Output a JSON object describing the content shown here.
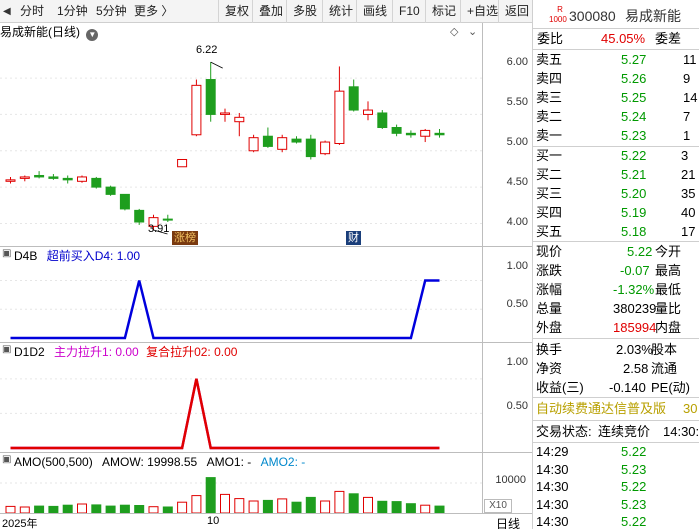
{
  "toolbar": {
    "items": [
      "分时",
      "1分钟",
      "5分钟",
      "更多 〉",
      "复权",
      "叠加",
      "多股",
      "统计",
      "画线",
      "F10",
      "标记",
      "+自选",
      "返回"
    ]
  },
  "main_chart": {
    "title": "易成新能(日线)",
    "y_ticks": [
      "6.00",
      "5.50",
      "5.00",
      "4.50",
      "4.00"
    ],
    "high_label": "6.22",
    "low_label": "3.91",
    "tag_zhangbang": "涨榜",
    "tag_cai": "财"
  },
  "d4b_pane": {
    "name": "D4B",
    "series_label": "超前买入D4: 1.00",
    "y_ticks": [
      "1.00",
      "0.50"
    ]
  },
  "d1d2_pane": {
    "name": "D1D2",
    "series1_label": "主力拉升1: 0.00",
    "series2_label": "复合拉升02: 0.00",
    "y_ticks": [
      "1.00",
      "0.50"
    ]
  },
  "amo_pane": {
    "label": "AMO(500,500)",
    "amow": "AMOW: 19998.55",
    "amo1": "AMO1: -",
    "amo2": "AMO2: -",
    "y_tick": "10000",
    "unit": "X10"
  },
  "bottom_axis": {
    "year": "2025年",
    "month": "10",
    "period": "日线"
  },
  "quote": {
    "badge_top": "R",
    "badge_bottom": "1000",
    "code": "300080",
    "name": "易成新能",
    "weibi_label": "委比",
    "weibi_value": "45.05%",
    "weicha_label": "委差",
    "sell_rows": [
      {
        "label": "卖五",
        "price": "5.27",
        "vol": "11"
      },
      {
        "label": "卖四",
        "price": "5.26",
        "vol": "9"
      },
      {
        "label": "卖三",
        "price": "5.25",
        "vol": "14"
      },
      {
        "label": "卖二",
        "price": "5.24",
        "vol": "7"
      },
      {
        "label": "卖一",
        "price": "5.23",
        "vol": "1"
      }
    ],
    "buy_rows": [
      {
        "label": "买一",
        "price": "5.22",
        "vol": "3"
      },
      {
        "label": "买二",
        "price": "5.21",
        "vol": "21"
      },
      {
        "label": "买三",
        "price": "5.20",
        "vol": "35"
      },
      {
        "label": "买四",
        "price": "5.19",
        "vol": "40"
      },
      {
        "label": "买五",
        "price": "5.18",
        "vol": "17"
      }
    ],
    "stats": [
      {
        "label": "现价",
        "value": "5.22",
        "label2": "今开"
      },
      {
        "label": "涨跌",
        "value": "-0.07",
        "label2": "最高"
      },
      {
        "label": "涨幅",
        "value": "-1.32%",
        "label2": "最低"
      },
      {
        "label": "总量",
        "value": "380239",
        "label2": "量比"
      },
      {
        "label": "外盘",
        "value": "185994",
        "label2": "内盘"
      }
    ],
    "stats2": [
      {
        "label": "换手",
        "value": "2.03%",
        "label2": "股本"
      },
      {
        "label": "净资",
        "value": "2.58",
        "label2": "流通"
      },
      {
        "label": "收益(三)",
        "value": "-0.140",
        "label2": "PE(动)"
      }
    ],
    "banner": "自动续费通达信普及版",
    "banner_num": "30",
    "trade_status_label": "交易状态:",
    "trade_status_value": "连续竞价",
    "trade_status_time": "14:30:2",
    "ticks": [
      {
        "time": "14:29",
        "price": "5.22"
      },
      {
        "time": "14:30",
        "price": "5.23"
      },
      {
        "time": "14:30",
        "price": "5.22"
      },
      {
        "time": "14:30",
        "price": "5.23"
      },
      {
        "time": "14:30",
        "price": "5.22"
      }
    ]
  },
  "chart_data": [
    {
      "type": "candlestick",
      "title": "易成新能(日线)",
      "ylim": [
        3.8,
        6.4
      ],
      "candles": [
        {
          "o": 4.6,
          "h": 4.64,
          "l": 4.55,
          "c": 4.58,
          "color": "red"
        },
        {
          "o": 4.62,
          "h": 4.66,
          "l": 4.58,
          "c": 4.64,
          "color": "red"
        },
        {
          "o": 4.66,
          "h": 4.72,
          "l": 4.62,
          "c": 4.64,
          "color": "green"
        },
        {
          "o": 4.64,
          "h": 4.68,
          "l": 4.6,
          "c": 4.62,
          "color": "green"
        },
        {
          "o": 4.62,
          "h": 4.66,
          "l": 4.55,
          "c": 4.6,
          "color": "green"
        },
        {
          "o": 4.58,
          "h": 4.66,
          "l": 4.56,
          "c": 4.64,
          "color": "red"
        },
        {
          "o": 4.62,
          "h": 4.64,
          "l": 4.48,
          "c": 4.5,
          "color": "green"
        },
        {
          "o": 4.5,
          "h": 4.52,
          "l": 4.38,
          "c": 4.4,
          "color": "green"
        },
        {
          "o": 4.4,
          "h": 4.4,
          "l": 4.18,
          "c": 4.2,
          "color": "green"
        },
        {
          "o": 4.18,
          "h": 4.2,
          "l": 3.98,
          "c": 4.02,
          "color": "green"
        },
        {
          "o": 3.96,
          "h": 4.12,
          "l": 3.91,
          "c": 4.08,
          "color": "red"
        },
        {
          "o": 4.06,
          "h": 4.12,
          "l": 4.02,
          "c": 4.06,
          "color": "green"
        },
        {
          "o": 4.78,
          "h": 4.88,
          "l": 4.78,
          "c": 4.88,
          "color": "red"
        },
        {
          "o": 5.22,
          "h": 5.98,
          "l": 5.2,
          "c": 5.9,
          "color": "red"
        },
        {
          "o": 5.98,
          "h": 6.22,
          "l": 5.4,
          "c": 5.5,
          "color": "green"
        },
        {
          "o": 5.52,
          "h": 5.58,
          "l": 5.4,
          "c": 5.5,
          "color": "red"
        },
        {
          "o": 5.4,
          "h": 5.52,
          "l": 5.2,
          "c": 5.46,
          "color": "red"
        },
        {
          "o": 5.0,
          "h": 5.22,
          "l": 4.98,
          "c": 5.18,
          "color": "red"
        },
        {
          "o": 5.2,
          "h": 5.32,
          "l": 5.04,
          "c": 5.06,
          "color": "green"
        },
        {
          "o": 5.02,
          "h": 5.22,
          "l": 4.98,
          "c": 5.18,
          "color": "red"
        },
        {
          "o": 5.16,
          "h": 5.2,
          "l": 5.1,
          "c": 5.12,
          "color": "green"
        },
        {
          "o": 5.16,
          "h": 5.22,
          "l": 4.88,
          "c": 4.92,
          "color": "green"
        },
        {
          "o": 4.96,
          "h": 5.14,
          "l": 4.94,
          "c": 5.12,
          "color": "red"
        },
        {
          "o": 5.1,
          "h": 6.16,
          "l": 5.08,
          "c": 5.82,
          "color": "red"
        },
        {
          "o": 5.88,
          "h": 5.98,
          "l": 5.54,
          "c": 5.56,
          "color": "green"
        },
        {
          "o": 5.56,
          "h": 5.68,
          "l": 5.42,
          "c": 5.5,
          "color": "red"
        },
        {
          "o": 5.52,
          "h": 5.56,
          "l": 5.3,
          "c": 5.32,
          "color": "green"
        },
        {
          "o": 5.32,
          "h": 5.36,
          "l": 5.2,
          "c": 5.24,
          "color": "green"
        },
        {
          "o": 5.24,
          "h": 5.28,
          "l": 5.18,
          "c": 5.22,
          "color": "green"
        },
        {
          "o": 5.2,
          "h": 5.3,
          "l": 5.12,
          "c": 5.28,
          "color": "red"
        },
        {
          "o": 5.24,
          "h": 5.3,
          "l": 5.18,
          "c": 5.22,
          "color": "green"
        }
      ]
    },
    {
      "type": "line",
      "title": "D4B",
      "series": [
        {
          "name": "超前买入D4",
          "values": [
            0,
            0,
            0,
            0,
            0,
            0,
            0,
            0,
            0,
            1,
            0,
            0,
            0,
            0,
            0,
            0,
            0,
            0,
            0,
            0,
            0,
            0,
            0,
            0,
            0,
            0,
            0,
            0,
            0,
            1,
            1
          ]
        }
      ],
      "ylim": [
        0,
        1.2
      ]
    },
    {
      "type": "line",
      "title": "D1D2",
      "series": [
        {
          "name": "主力拉升1",
          "values": [
            0,
            0,
            0,
            0,
            0,
            0,
            0,
            0,
            0,
            0,
            0,
            0,
            0,
            1,
            0,
            0,
            0,
            0,
            0,
            0,
            0,
            0,
            0,
            0,
            0,
            0,
            0,
            0,
            0,
            0,
            0
          ]
        },
        {
          "name": "复合拉升02",
          "values": [
            0,
            0,
            0,
            0,
            0,
            0,
            0,
            0,
            0,
            0,
            0,
            0,
            0,
            1,
            0,
            0,
            0,
            0,
            0,
            0,
            0,
            0,
            0,
            0,
            0,
            0,
            0,
            0,
            0,
            0,
            0
          ]
        }
      ],
      "ylim": [
        0,
        1.2
      ]
    },
    {
      "type": "bar",
      "title": "AMO(500,500)",
      "unit": "X10",
      "values": [
        2200,
        2000,
        2300,
        2200,
        2600,
        3000,
        2700,
        2300,
        2600,
        2500,
        2100,
        2000,
        3600,
        5800,
        11800,
        6200,
        4800,
        4000,
        4200,
        4700,
        3600,
        5200,
        4000,
        7200,
        6400,
        5200,
        3900,
        3800,
        3100,
        2600,
        2300
      ],
      "colors": [
        "red",
        "red",
        "green",
        "green",
        "green",
        "red",
        "green",
        "green",
        "green",
        "green",
        "red",
        "green",
        "red",
        "red",
        "green",
        "red",
        "red",
        "red",
        "green",
        "red",
        "green",
        "green",
        "red",
        "red",
        "green",
        "red",
        "green",
        "green",
        "green",
        "red",
        "green"
      ],
      "ylim": [
        0,
        14000
      ]
    }
  ]
}
